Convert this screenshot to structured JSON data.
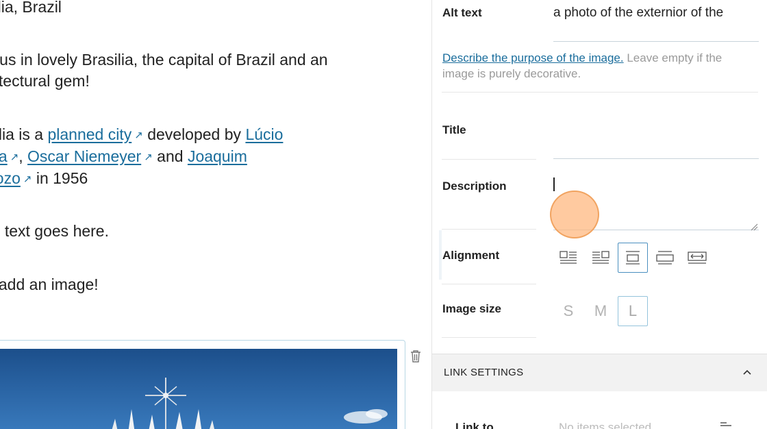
{
  "editor": {
    "location_line": "silia, Brazil",
    "intro_line1": "n us in lovely Brasilia, the capital of Brazil and an",
    "intro_line2": "nitectural gem!",
    "para2_prefix": "sília is a ",
    "link_planned_city": "planned city",
    "para2_mid1": " developed by ",
    "link_lucio_a": "Lúcio ",
    "link_lucio_b": "sta",
    "para2_comma": ", ",
    "link_oscar": "Oscar Niemeyer",
    "para2_and": " and ",
    "link_joaquim_a": "Joaquim ",
    "link_joaquim_b": "dozo",
    "para2_year": " in 1956",
    "more_text": "re text goes here.",
    "add_image": "s add an image!"
  },
  "panel": {
    "alt_text": {
      "label": "Alt text",
      "value": "a photo of the externior of the"
    },
    "help": {
      "link": "Describe the purpose of the image.",
      "rest": " Leave empty if the image is purely decorative."
    },
    "title": {
      "label": "Title",
      "value": ""
    },
    "description": {
      "label": "Description",
      "value": ""
    },
    "alignment": {
      "label": "Alignment",
      "options": [
        "align-left-icon",
        "align-right-icon",
        "align-center-icon",
        "align-wide-icon",
        "align-full-icon"
      ],
      "selected": "align-center-icon"
    },
    "image_size": {
      "label": "Image size",
      "options": [
        "S",
        "M",
        "L"
      ],
      "selected": "L"
    },
    "link_settings": {
      "title": "LINK SETTINGS",
      "link_to_label": "Link to",
      "placeholder": "No items selected"
    }
  },
  "colors": {
    "link": "#1a6d9c",
    "accent_border": "#4a8fbf",
    "touch_indicator": "#ffb478"
  }
}
